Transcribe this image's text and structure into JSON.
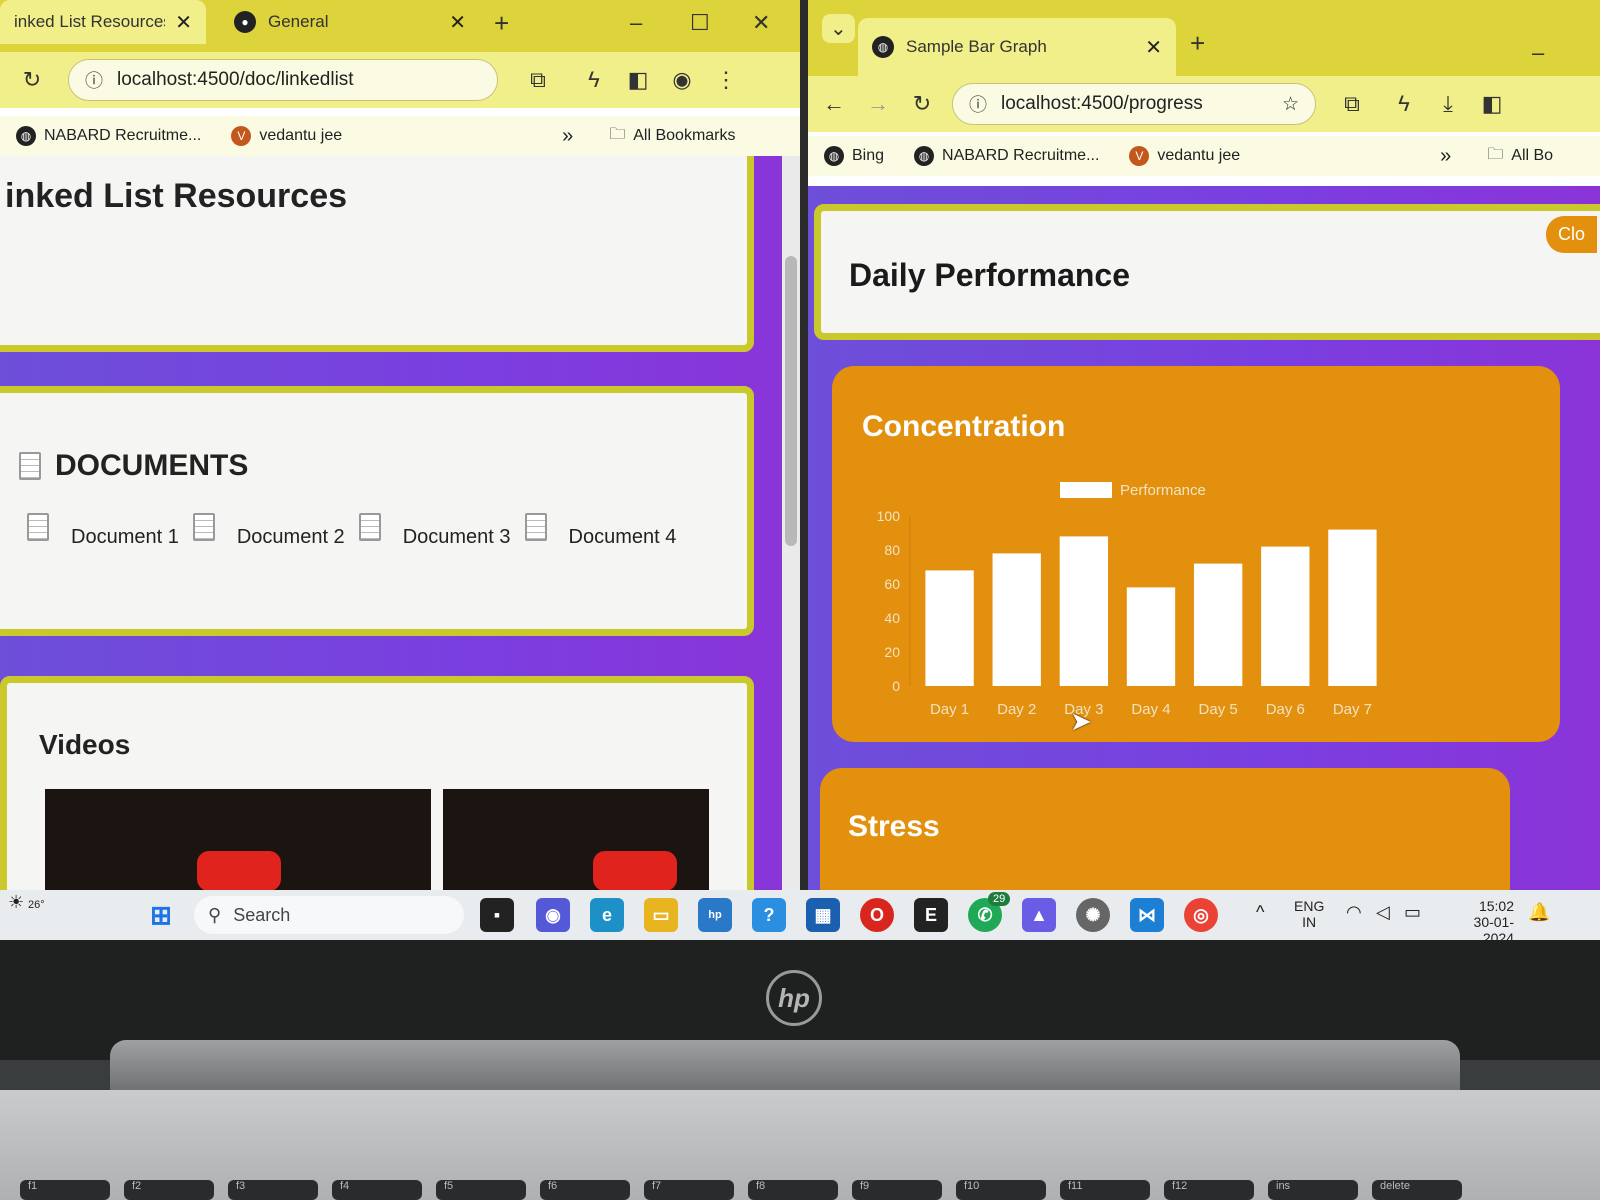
{
  "left_browser": {
    "tabs": [
      {
        "label": "inked List Resources",
        "active": true
      },
      {
        "label": "General",
        "active": false
      }
    ],
    "new_tab": "+",
    "url": "localhost:4500/doc/linkedlist",
    "bookmarks": [
      {
        "label": "NABARD Recruitme...",
        "icon": "globe-icon"
      },
      {
        "label": "vedantu jee",
        "icon": "v-icon"
      }
    ],
    "all_bookmarks": "All Bookmarks",
    "page": {
      "title": "inked List Resources",
      "documents_heading": "DOCUMENTS",
      "documents": [
        "Document 1",
        "Document 2",
        "Document 3",
        "Document 4"
      ],
      "videos_heading": "Videos"
    }
  },
  "right_browser": {
    "tabs": [
      {
        "label": "Sample Bar Graph",
        "active": true
      }
    ],
    "new_tab": "+",
    "url": "localhost:4500/progress",
    "bookmarks": [
      {
        "label": "Bing",
        "icon": "globe-icon"
      },
      {
        "label": "NABARD Recruitme...",
        "icon": "globe-icon"
      },
      {
        "label": "vedantu jee",
        "icon": "v-icon"
      }
    ],
    "all_bookmarks": "All Bo",
    "page": {
      "header_title": "Daily Performance",
      "close_label": "Clo",
      "cards": [
        {
          "title": "Concentration"
        },
        {
          "title": "Stress"
        }
      ]
    }
  },
  "chart_data": {
    "type": "bar",
    "title": "",
    "categories": [
      "Day 1",
      "Day 2",
      "Day 3",
      "Day 4",
      "Day 5",
      "Day 6",
      "Day 7"
    ],
    "series": [
      {
        "name": "Performance",
        "values": [
          68,
          78,
          88,
          58,
          72,
          82,
          92
        ],
        "color": "#ffffff"
      }
    ],
    "ylim": [
      0,
      100
    ],
    "yticks": [
      0,
      20,
      40,
      60,
      80,
      100
    ],
    "legend": "top",
    "grid": false
  },
  "taskbar": {
    "weather": "26°",
    "search_placeholder": "Search",
    "whatsapp_badge": "29",
    "lang_top": "ENG",
    "lang_bottom": "IN",
    "time": "15:02",
    "date": "30-01-2024"
  },
  "keyboard": {
    "fkeys": [
      "f1",
      "f2",
      "f3",
      "f4",
      "f5",
      "f6",
      "f7",
      "f8",
      "f9",
      "f10",
      "f11",
      "f12",
      "ins",
      "delete"
    ]
  },
  "colors": {
    "tabstrip": "#ddd33a",
    "purple_bg": "#7b3ee0",
    "card_border": "#c9c92c",
    "orange_card": "#e3900e"
  }
}
